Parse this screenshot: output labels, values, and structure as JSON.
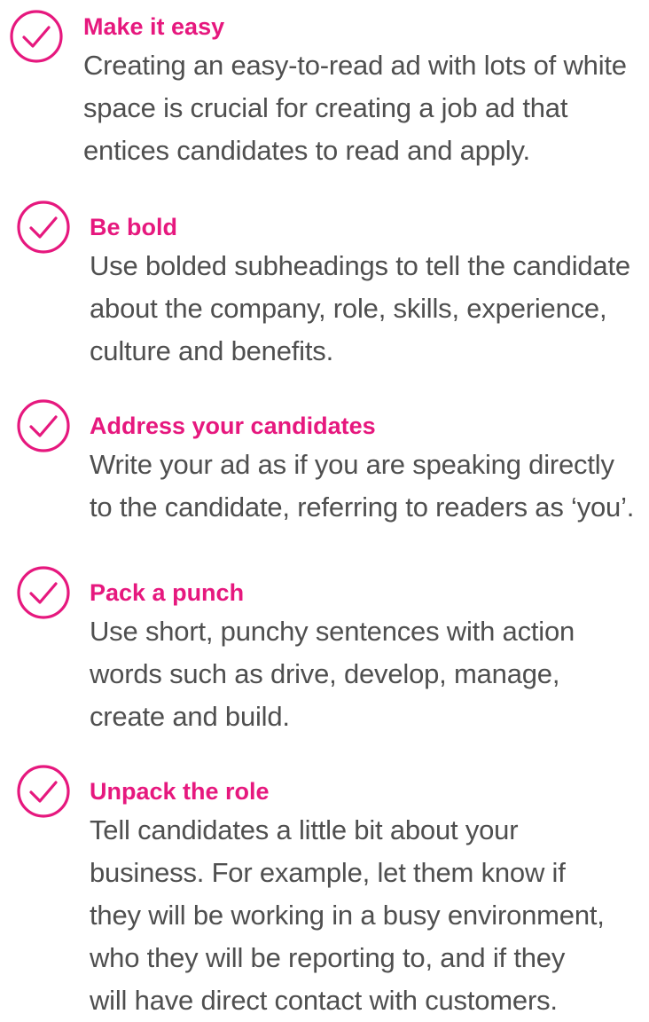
{
  "accent_color": "#e6187e",
  "body_color": "#4f4f4f",
  "icon": "check-circle-icon",
  "tips": [
    {
      "title": "Make it easy",
      "lines": [
        "Creating an easy-to-read ad with lots of white",
        "space is crucial for creating a job ad that",
        "entices candidates to read and apply."
      ]
    },
    {
      "title": "Be bold",
      "lines": [
        "Use bolded subheadings to tell the candidate",
        "about the company, role, skills, experience,",
        "culture and benefits."
      ]
    },
    {
      "title": "Address your candidates",
      "lines": [
        "Write your ad as if you are speaking directly",
        "to the candidate, referring to readers as ‘you’."
      ]
    },
    {
      "title": "Pack a punch",
      "lines": [
        "Use short, punchy sentences with action",
        "words such as drive, develop, manage,",
        "create and build."
      ]
    },
    {
      "title": "Unpack the role",
      "lines": [
        "Tell candidates a little bit about your",
        "business. For example, let them know if",
        "they will be working in a busy environment,",
        "who they will be reporting to, and if they",
        "will have direct contact with customers."
      ]
    }
  ]
}
